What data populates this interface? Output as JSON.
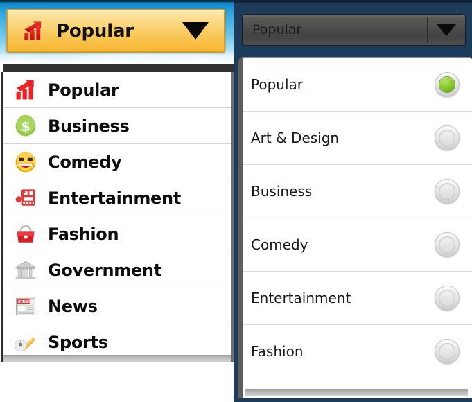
{
  "left_panel": {
    "spinner": {
      "label": "Popular",
      "icon": "chart-bars-icon",
      "caret": "chevron-down-icon",
      "background_color": "#f9c757",
      "border_color": "#d99a1f"
    },
    "dropdown_items": [
      {
        "label": "Popular",
        "icon": "chart-bars-icon"
      },
      {
        "label": "Business",
        "icon": "dollar-coin-icon"
      },
      {
        "label": "Comedy",
        "icon": "laughing-face-icon"
      },
      {
        "label": "Entertainment",
        "icon": "film-music-icon"
      },
      {
        "label": "Fashion",
        "icon": "handbag-icon"
      },
      {
        "label": "Government",
        "icon": "bank-building-icon"
      },
      {
        "label": "News",
        "icon": "newspaper-icon"
      },
      {
        "label": "Sports",
        "icon": "sports-ball-icon"
      }
    ]
  },
  "right_panel": {
    "header_color": "#1d3c5c",
    "spinner": {
      "label": "Popular",
      "caret": "chevron-down-icon"
    },
    "dropdown_items": [
      {
        "label": "Popular",
        "selected": true
      },
      {
        "label": "Art & Design",
        "selected": false
      },
      {
        "label": "Business",
        "selected": false
      },
      {
        "label": "Comedy",
        "selected": false
      },
      {
        "label": "Entertainment",
        "selected": false
      },
      {
        "label": "Fashion",
        "selected": false
      }
    ],
    "selected_color": "#8fcc33"
  }
}
